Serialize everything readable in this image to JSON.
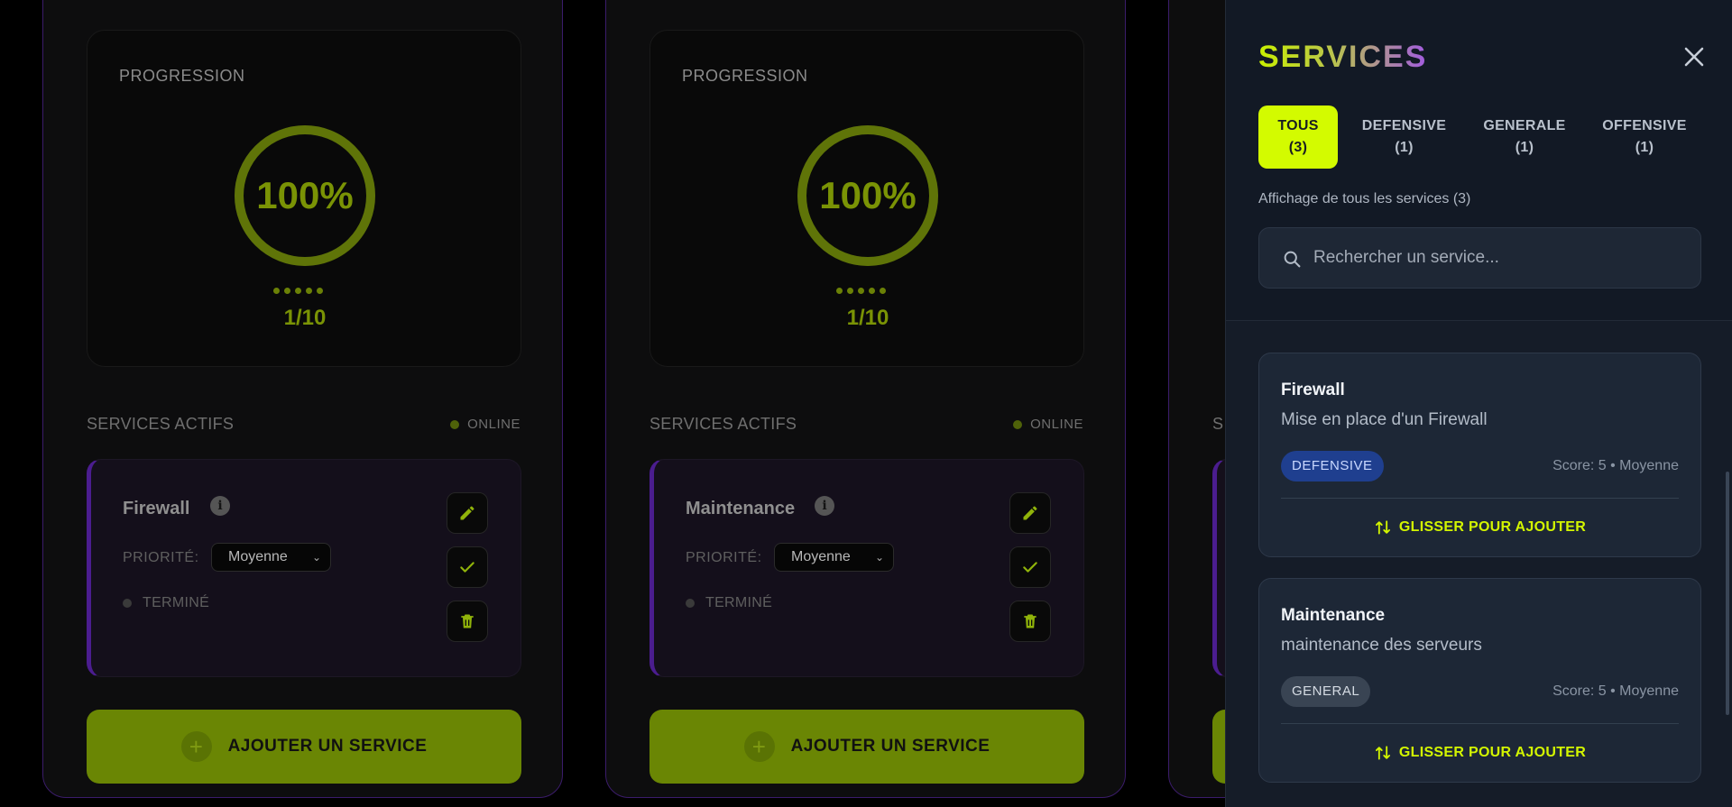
{
  "cards": [
    {
      "progress_label": "PROGRESSION",
      "percent_text": "100%",
      "progress": 1.0,
      "ratio": "1/10",
      "section_label": "SERVICES ACTIFS",
      "online_label": "ONLINE",
      "service": {
        "title": "Firewall",
        "priority_label": "PRIORITÉ:",
        "priority_value": "Moyenne",
        "status": "TERMINÉ"
      },
      "add_label": "AJOUTER UN SERVICE"
    },
    {
      "progress_label": "PROGRESSION",
      "percent_text": "100%",
      "progress": 1.0,
      "ratio": "1/10",
      "section_label": "SERVICES ACTIFS",
      "online_label": "ONLINE",
      "service": {
        "title": "Maintenance",
        "priority_label": "PRIORITÉ:",
        "priority_value": "Moyenne",
        "status": "TERMINÉ"
      },
      "add_label": "AJOUTER UN SERVICE"
    },
    {
      "section_label_partial": "S"
    }
  ],
  "panel": {
    "title": "SERVICES",
    "tabs": [
      {
        "name": "TOUS",
        "count": "(3)",
        "active": true
      },
      {
        "name": "DEFENSIVE",
        "count": "(1)",
        "active": false
      },
      {
        "name": "GENERALE",
        "count": "(1)",
        "active": false
      },
      {
        "name": "OFFENSIVE",
        "count": "(1)",
        "active": false
      }
    ],
    "filter_info": "Affichage de tous les services (3)",
    "search_placeholder": "Rechercher un service...",
    "items": [
      {
        "title": "Firewall",
        "description": "Mise en place d'un Firewall",
        "category": "DEFENSIVE",
        "meta": "Score: 5  •  Moyenne",
        "drag_label": "GLISSER POUR AJOUTER"
      },
      {
        "title": "Maintenance",
        "description": "maintenance des serveurs",
        "category": "GENERAL",
        "meta": "Score: 5  •  Moyenne",
        "drag_label": "GLISSER POUR AJOUTER"
      }
    ]
  },
  "colors": {
    "accent": "#d3fb00",
    "accent_dim": "#6a8604",
    "card_border": "#3b1c6b",
    "service_border": "#4b1d8f",
    "badge_defensive": "#1f3f8f",
    "badge_general": "#394453"
  },
  "icons": [
    "info-icon",
    "pencil-icon",
    "check-icon",
    "trash-icon",
    "plus-icon",
    "close-icon",
    "search-icon",
    "swap-vertical-icon"
  ]
}
